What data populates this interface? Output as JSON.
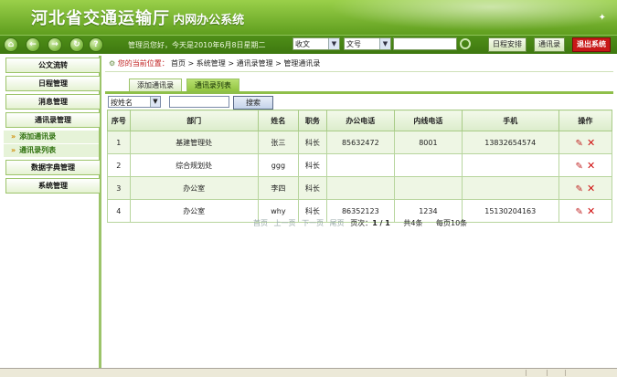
{
  "header": {
    "title": "河北省交通运输厅",
    "subtitle": "内网办公系统"
  },
  "toolbar": {
    "welcome": "管理员您好，今天是2010年6月8日星期二",
    "select1": "收文",
    "select2": "文号",
    "buttons": [
      "日程安排",
      "通讯录",
      "退出系统"
    ]
  },
  "sidebar": {
    "menu": [
      "公文流转",
      "日程管理",
      "消息管理",
      "通讯录管理"
    ],
    "sub": [
      "添加通讯录",
      "通讯录列表"
    ],
    "menu2": [
      "数据字典管理",
      "系统管理"
    ]
  },
  "crumb": {
    "label": "您的当前位置：",
    "path": "首页 > 系统管理 > 通讯录管理 > 管理通讯录"
  },
  "tabs": [
    "添加通讯录",
    "通讯录列表"
  ],
  "filter": {
    "select": "按姓名",
    "button": "搜索"
  },
  "table": {
    "headers": [
      "序号",
      "部门",
      "姓名",
      "职务",
      "办公电话",
      "内线电话",
      "手机",
      "操作"
    ],
    "rows": [
      [
        "1",
        "基建管理处",
        "张三",
        "科长",
        "85632472",
        "8001",
        "13832654574"
      ],
      [
        "2",
        "综合规划处",
        "ggg",
        "科长",
        "",
        "",
        ""
      ],
      [
        "3",
        "办公室",
        "李四",
        "科长",
        "",
        "",
        ""
      ],
      [
        "4",
        "办公室",
        "why",
        "科长",
        "86352123",
        "1234",
        "15130204163"
      ]
    ]
  },
  "pager": {
    "first": "首页",
    "prev": "上一页",
    "next": "下一页",
    "last": "尾页",
    "page_label": "页次：",
    "page": "1 / 1",
    "total": "共4条",
    "per_page": "每页10条"
  }
}
